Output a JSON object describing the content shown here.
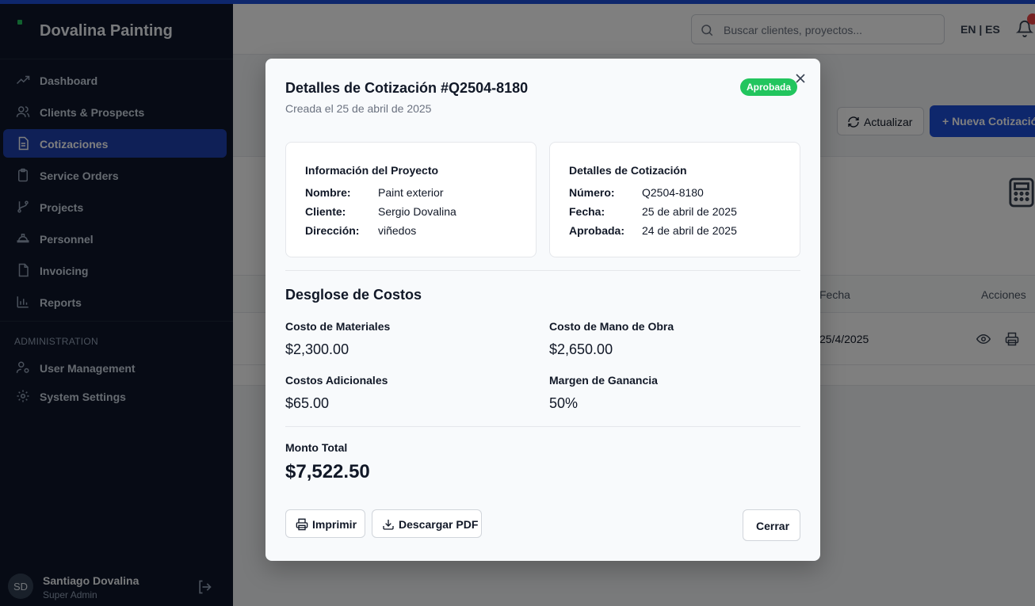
{
  "app": {
    "name": "Dovalina Painting"
  },
  "sidebar": {
    "items": [
      {
        "label": "Dashboard",
        "icon": "trending-up-icon"
      },
      {
        "label": "Clients & Prospects",
        "icon": "users-icon"
      },
      {
        "label": "Cotizaciones",
        "icon": "document-icon",
        "active": true
      },
      {
        "label": "Service Orders",
        "icon": "clipboard-icon"
      },
      {
        "label": "Projects",
        "icon": "git-branch-icon"
      },
      {
        "label": "Personnel",
        "icon": "hard-hat-icon"
      },
      {
        "label": "Invoicing",
        "icon": "file-icon"
      },
      {
        "label": "Reports",
        "icon": "bar-chart-icon"
      }
    ],
    "admin_title": "ADMINISTRATION",
    "admin_items": [
      {
        "label": "User Management",
        "icon": "user-cog-icon"
      },
      {
        "label": "System Settings",
        "icon": "gear-icon"
      }
    ],
    "user": {
      "initials": "SD",
      "name": "Santiago Dovalina",
      "role": "Super Admin"
    }
  },
  "header": {
    "search_placeholder": "Buscar clientes, proyectos...",
    "lang": "EN | ES"
  },
  "toolbar": {
    "refresh_label": "Actualizar",
    "new_label": "+ Nueva Cotización"
  },
  "table": {
    "headers": {
      "fecha": "Fecha",
      "acciones": "Acciones"
    },
    "rows": [
      {
        "fecha": "25/4/2025"
      }
    ]
  },
  "modal": {
    "title": "Detalles de Cotización #Q2504-8180",
    "subtitle": "Creada el 25 de abril de 2025",
    "status": "Aprobada",
    "project_info": {
      "title": "Información del Proyecto",
      "rows": [
        {
          "key": "Nombre:",
          "value": "Paint exterior"
        },
        {
          "key": "Cliente:",
          "value": "Sergio Dovalina"
        },
        {
          "key": "Dirección:",
          "value": "viñedos"
        }
      ]
    },
    "quote_info": {
      "title": "Detalles de Cotización",
      "rows": [
        {
          "key": "Número:",
          "value": "Q2504-8180"
        },
        {
          "key": "Fecha:",
          "value": "25 de abril de 2025"
        },
        {
          "key": "Aprobada:",
          "value": "24 de abril de 2025"
        }
      ]
    },
    "cost_breakdown": {
      "title": "Desglose de Costos",
      "materials_label": "Costo de Materiales",
      "materials_value": "$2,300.00",
      "labor_label": "Costo de Mano de Obra",
      "labor_value": "$2,650.00",
      "additional_label": "Costos Adicionales",
      "additional_value": "$65.00",
      "margin_label": "Margen de Ganancia",
      "margin_value": "50%"
    },
    "total_label": "Monto Total",
    "total_value": "$7,522.50",
    "buttons": {
      "print": "Imprimir",
      "pdf": "Descargar PDF",
      "close": "Cerrar"
    }
  },
  "colors": {
    "accent": "#1d4ed8",
    "success": "#22c55e",
    "sidebar_bg": "#0f172a"
  }
}
